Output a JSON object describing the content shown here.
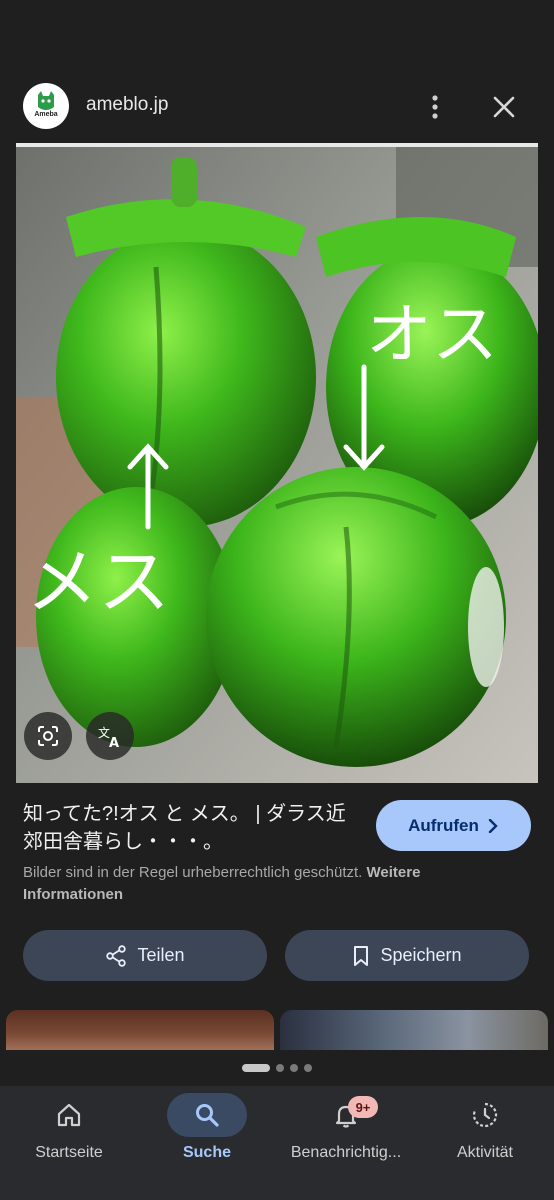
{
  "header": {
    "logo_text": "Ameba",
    "domain": "ameblo.jp"
  },
  "image": {
    "overlay_text_right": "オス",
    "overlay_text_left": "メス"
  },
  "result": {
    "title": "知ってた?!オス と メス。 | ダラス近郊田舎暮らし・・・。",
    "visit_label": "Aufrufen",
    "copyright_text": "Bilder sind in der Regel urheberrechtlich geschützt.",
    "copyright_link": "Weitere Informationen"
  },
  "actions": {
    "share_label": "Teilen",
    "save_label": "Speichern"
  },
  "nav": {
    "items": [
      {
        "label": "Startseite",
        "icon": "home-icon"
      },
      {
        "label": "Suche",
        "icon": "search-icon"
      },
      {
        "label": "Benachrichtig...",
        "icon": "bell-icon"
      },
      {
        "label": "Aktivität",
        "icon": "activity-icon"
      }
    ],
    "badge": "9+"
  },
  "colors": {
    "accent": "#a8c7fa",
    "button_bg": "#3c4656",
    "background": "#1f1f1f"
  }
}
